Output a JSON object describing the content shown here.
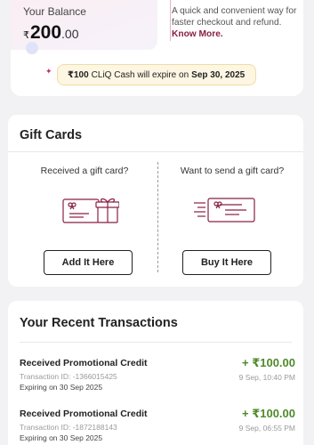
{
  "balance": {
    "label": "Your Balance",
    "currency_symbol": "₹",
    "amount_int": "200",
    "amount_dec": ".00",
    "info_text": "A quick and convenient way for faster checkout and refund.",
    "know_more": "Know More.",
    "expiry": {
      "currency_symbol": "₹",
      "amount": "100",
      "text": "CLiQ Cash will expire on",
      "date": "Sep 30, 2025"
    }
  },
  "gift_cards": {
    "title": "Gift Cards",
    "received": {
      "question": "Received a gift card?",
      "button_label": "Add It Here",
      "icon": "gift-card-with-box-icon"
    },
    "send": {
      "question": "Want to send a gift card?",
      "button_label": "Buy It Here",
      "icon": "send-gift-card-icon"
    }
  },
  "transactions": {
    "title": "Your Recent Transactions",
    "items": [
      {
        "name": "Received Promotional Credit",
        "transaction_id": "Transaction ID: -1366015425",
        "expiring": "Expiring on 30 Sep 2025",
        "amount": "+ ₹100.00",
        "time": "9 Sep, 10:40 PM"
      },
      {
        "name": "Received Promotional Credit",
        "transaction_id": "Transaction ID: -1872188143",
        "expiring": "Expiring on 30 Sep 2025",
        "amount": "+ ₹100.00",
        "time": "9 Sep, 06:55 PM"
      }
    ]
  },
  "colors": {
    "accent": "#8a1e45",
    "credit_green": "#4f8a2b",
    "pill_bg": "#fdf6e3",
    "pill_border": "#f2dca2"
  }
}
